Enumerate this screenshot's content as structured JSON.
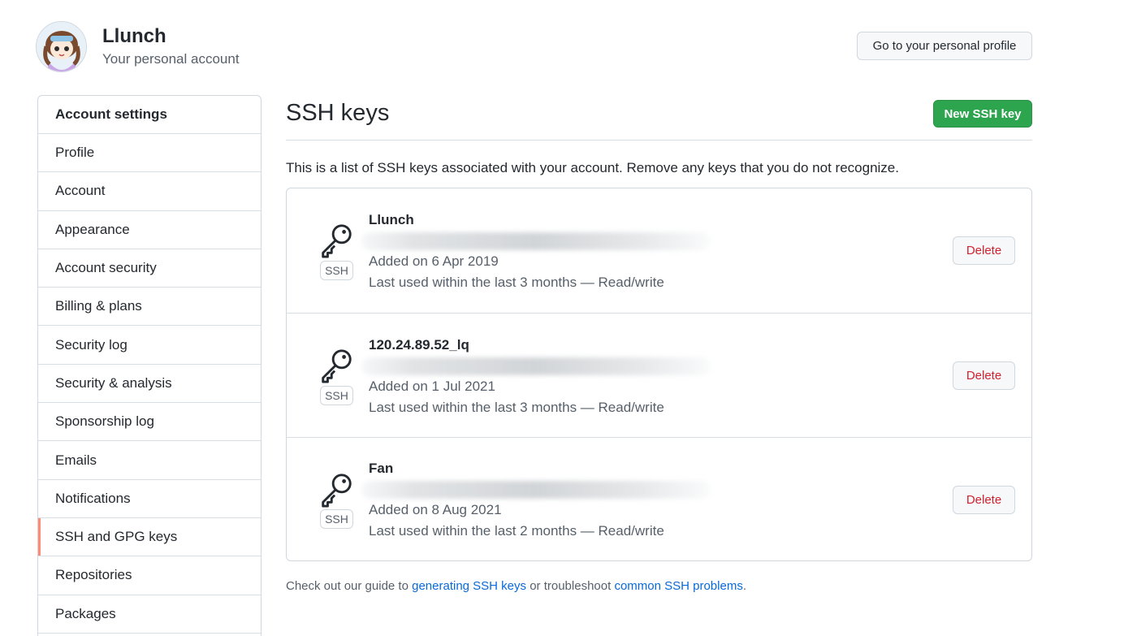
{
  "header": {
    "user_name": "Llunch",
    "user_subtitle": "Your personal account",
    "profile_button": "Go to your personal profile"
  },
  "sidebar": {
    "heading": "Account settings",
    "items": [
      {
        "label": "Profile",
        "active": false
      },
      {
        "label": "Account",
        "active": false
      },
      {
        "label": "Appearance",
        "active": false
      },
      {
        "label": "Account security",
        "active": false
      },
      {
        "label": "Billing & plans",
        "active": false
      },
      {
        "label": "Security log",
        "active": false
      },
      {
        "label": "Security & analysis",
        "active": false
      },
      {
        "label": "Sponsorship log",
        "active": false
      },
      {
        "label": "Emails",
        "active": false
      },
      {
        "label": "Notifications",
        "active": false
      },
      {
        "label": "SSH and GPG keys",
        "active": true
      },
      {
        "label": "Repositories",
        "active": false
      },
      {
        "label": "Packages",
        "active": false
      }
    ],
    "active_accent": "#fd8c73"
  },
  "main": {
    "title": "SSH keys",
    "new_button": "New SSH key",
    "intro": "This is a list of SSH keys associated with your account. Remove any keys that you do not recognize.",
    "keys": [
      {
        "title": "Llunch",
        "badge": "SSH",
        "added": "Added on 6 Apr 2019",
        "last_used": "Last used within the last 3 months — Read/write",
        "delete_label": "Delete",
        "icon": "key-icon"
      },
      {
        "title": "120.24.89.52_lq",
        "badge": "SSH",
        "added": "Added on 1 Jul 2021",
        "last_used": "Last used within the last 3 months — Read/write",
        "delete_label": "Delete",
        "icon": "key-icon"
      },
      {
        "title": "Fan",
        "badge": "SSH",
        "added": "Added on 8 Aug 2021",
        "last_used": "Last used within the last 2 months — Read/write",
        "delete_label": "Delete",
        "icon": "key-icon"
      }
    ],
    "footer": {
      "prefix": "Check out our guide to ",
      "link1": "generating SSH keys",
      "middle": " or troubleshoot ",
      "link2": "common SSH problems",
      "suffix": "."
    }
  },
  "colors": {
    "primary_button": "#2da44e",
    "danger_text": "#cf222e",
    "link": "#0969da"
  }
}
